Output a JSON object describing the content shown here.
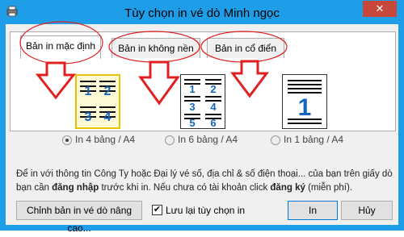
{
  "window": {
    "title": "Tùy chọn in vé dò Minh ngọc",
    "close_glyph": "✕"
  },
  "tabs": [
    {
      "label": "Bản in mặc định",
      "active": true
    },
    {
      "label": "Bản in không nền",
      "active": false
    },
    {
      "label": "Bản in cổ điển",
      "active": false
    }
  ],
  "layouts": [
    {
      "label": "In 4 bảng / A4",
      "selected": true,
      "numbers": [
        "1",
        "2",
        "3",
        "4"
      ]
    },
    {
      "label": "In 6 bảng / A4",
      "selected": false,
      "numbers": [
        "1",
        "2",
        "3",
        "4",
        "5",
        "6"
      ]
    },
    {
      "label": "In 1 bảng / A4",
      "selected": false,
      "numbers": [
        "1"
      ]
    }
  ],
  "info": {
    "part1": "Để in với thông tin Công Ty hoặc Đại lý vé số, địa chỉ & số điện thoại... của bạn trên giấy dò bạn cần ",
    "login": "đăng nhập",
    "part2": " trước khi in. Nếu chưa có tài khoản click ",
    "register": "đăng ký",
    "part3": " (miễn phí)."
  },
  "buttons": {
    "advanced": "Chỉnh bản in vé dò nâng cao...",
    "print": "In",
    "cancel": "Hủy"
  },
  "save_option": {
    "label": "Lưu lại tùy chọn in",
    "checked": true,
    "mark": "✔"
  },
  "colors": {
    "title_bar": "#1e9de9",
    "close_button": "#c7483a",
    "annotation": "#e02020",
    "digit_blue": "#1565c0",
    "selected_border": "#e8c200"
  }
}
